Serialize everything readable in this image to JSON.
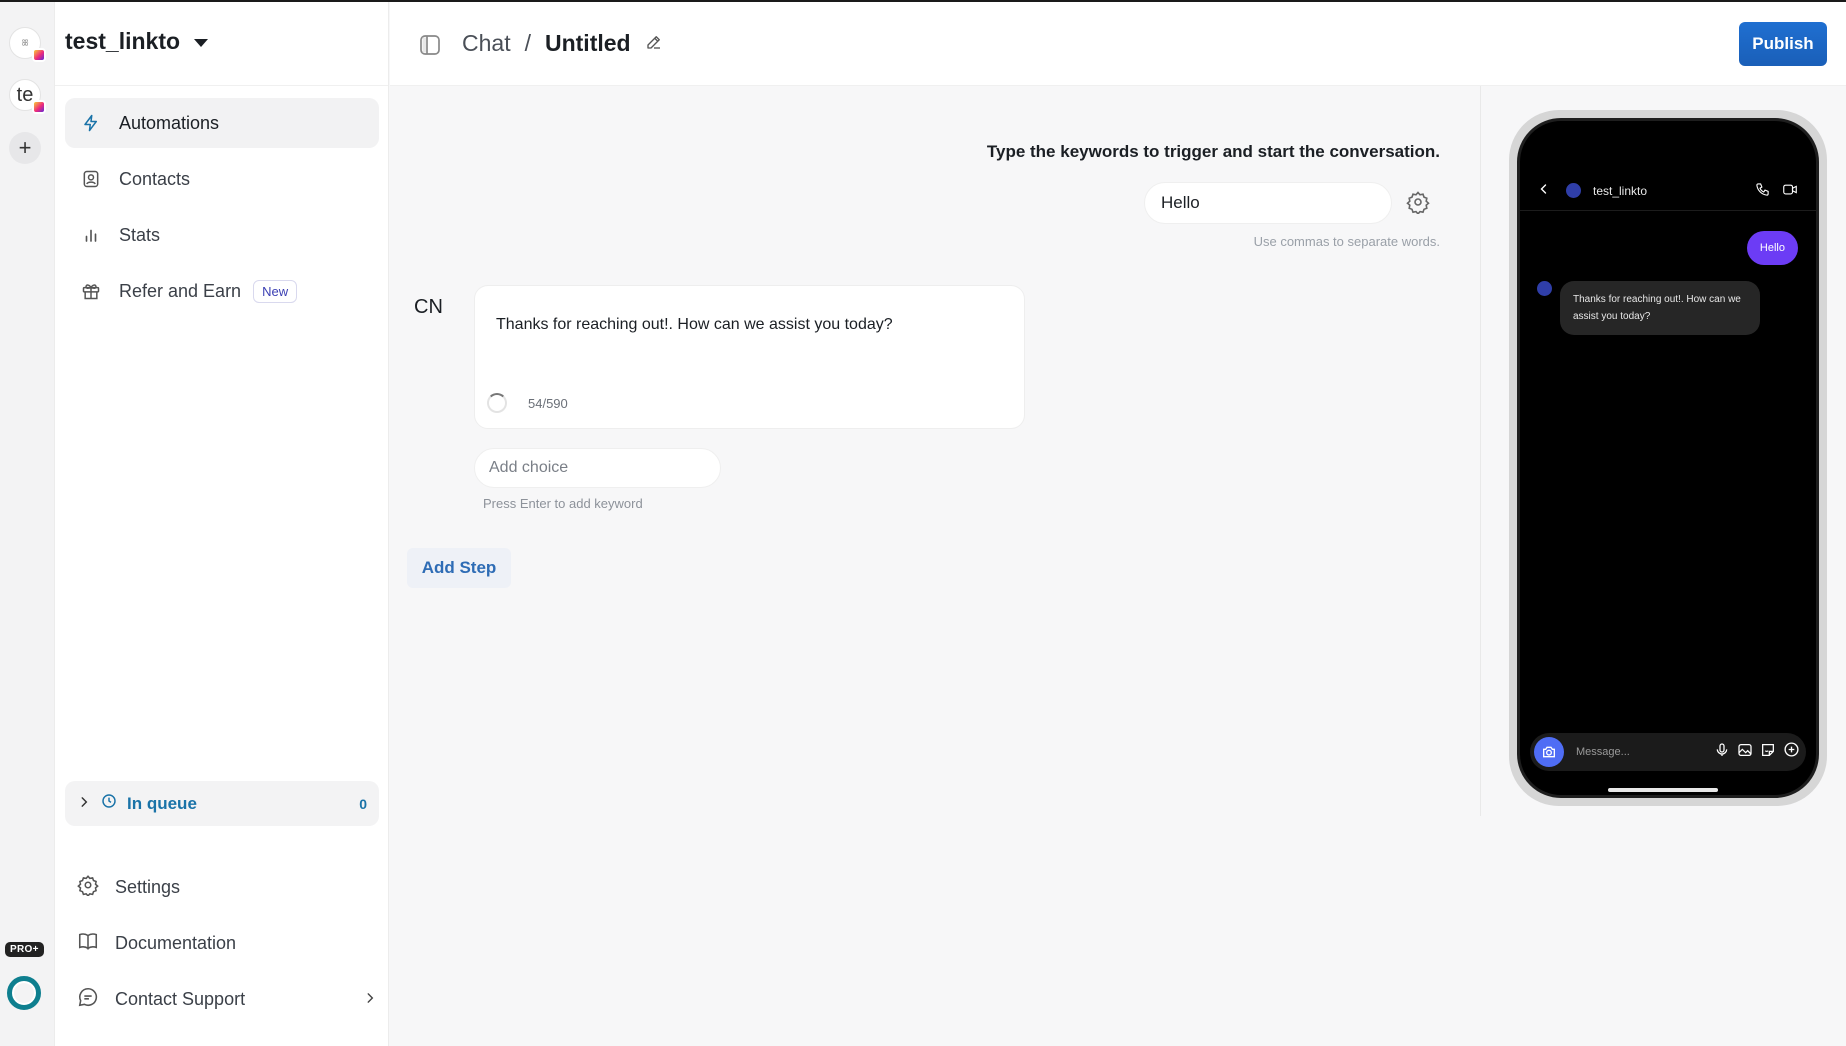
{
  "rail": {
    "accounts": [
      {
        "initials": ""
      },
      {
        "initials": "te"
      }
    ],
    "add_label": "+",
    "plan_badge": "PRO+"
  },
  "sidebar": {
    "workspace": "test_linkto",
    "items": [
      {
        "label": "Automations",
        "icon": "lightning-icon",
        "active": true
      },
      {
        "label": "Contacts",
        "icon": "contact-card-icon"
      },
      {
        "label": "Stats",
        "icon": "bar-chart-icon"
      },
      {
        "label": "Refer and Earn",
        "icon": "gift-icon",
        "badge": "New"
      }
    ],
    "queue": {
      "label": "In queue",
      "count": "0"
    },
    "bottom_items": [
      {
        "label": "Settings",
        "icon": "gear-icon"
      },
      {
        "label": "Documentation",
        "icon": "book-icon"
      },
      {
        "label": "Contact Support",
        "icon": "chat-support-icon"
      }
    ]
  },
  "header": {
    "section": "Chat",
    "separator": "/",
    "title": "Untitled",
    "publish_label": "Publish"
  },
  "trigger": {
    "title": "Type the keywords to trigger and start the conversation.",
    "keyword_value": "Hello",
    "hint": "Use commas to separate words."
  },
  "step": {
    "sender": "CN",
    "message": "Thanks for reaching out!. How can we assist you today?",
    "char_count": "54/590",
    "choice_placeholder": "Add choice",
    "choice_hint": "Press Enter to add keyword",
    "add_step_label": "Add Step"
  },
  "preview": {
    "username": "test_linkto",
    "outgoing": "Hello",
    "incoming": "Thanks for reaching out!. How can we assist you today?",
    "composer_placeholder": "Message...",
    "accent": "#6c3cf5"
  }
}
